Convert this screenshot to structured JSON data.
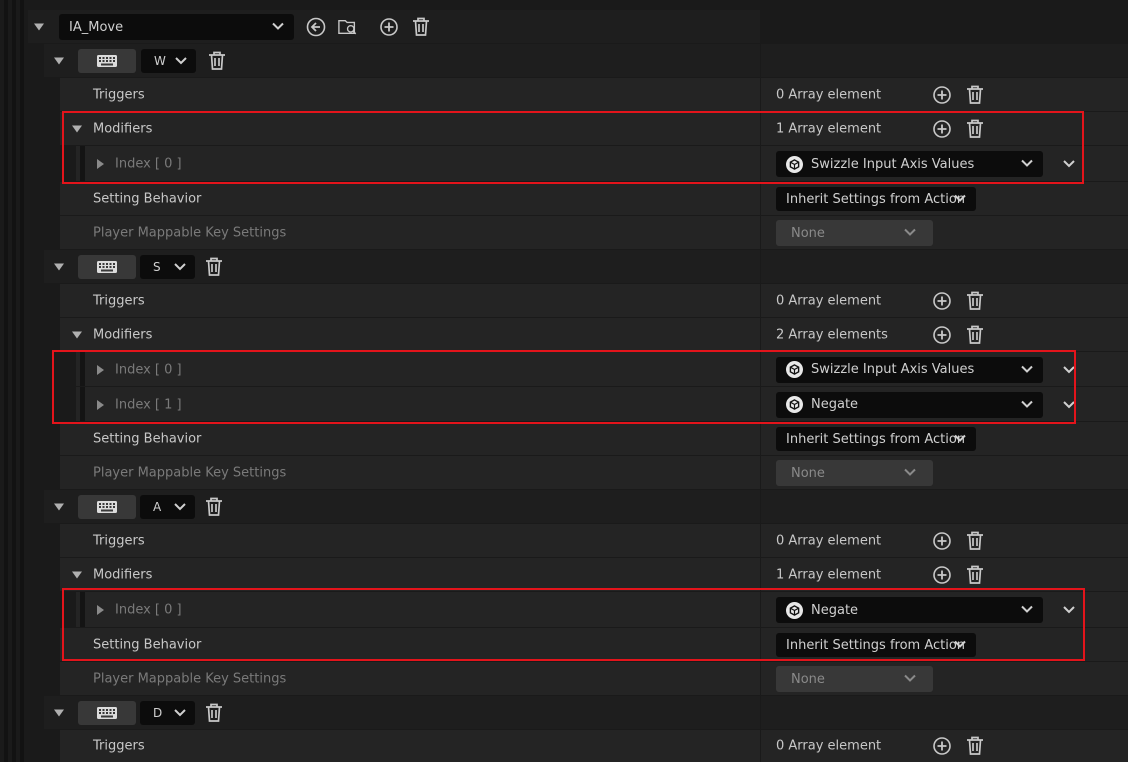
{
  "action": {
    "name": "IA_Move"
  },
  "labels": {
    "triggers": "Triggers",
    "modifiers": "Modifiers",
    "setting_behavior": "Setting Behavior",
    "player_mappable": "Player Mappable Key Settings",
    "index0": "Index [ 0 ]",
    "index1": "Index [ 1 ]"
  },
  "mappings": [
    {
      "key": "W",
      "triggers_count": "0 Array element",
      "modifiers_count": "1 Array element",
      "modifiers": [
        {
          "index": "Index [ 0 ]",
          "value": "Swizzle Input Axis Values"
        }
      ],
      "setting_behavior": "Inherit Settings from Action",
      "player_mappable": "None"
    },
    {
      "key": "S",
      "triggers_count": "0 Array element",
      "modifiers_count": "2 Array elements",
      "modifiers": [
        {
          "index": "Index [ 0 ]",
          "value": "Swizzle Input Axis Values"
        },
        {
          "index": "Index [ 1 ]",
          "value": "Negate"
        }
      ],
      "setting_behavior": "Inherit Settings from Action",
      "player_mappable": "None"
    },
    {
      "key": "A",
      "triggers_count": "0 Array element",
      "modifiers_count": "1 Array element",
      "modifiers": [
        {
          "index": "Index [ 0 ]",
          "value": "Negate"
        }
      ],
      "setting_behavior": "Inherit Settings from Action",
      "player_mappable": "None"
    },
    {
      "key": "D",
      "triggers_count": "0 Array element"
    }
  ],
  "colors": {
    "highlight": "#e3141b",
    "row_bg": "#242424",
    "combo_bg": "#0c0c0c"
  }
}
